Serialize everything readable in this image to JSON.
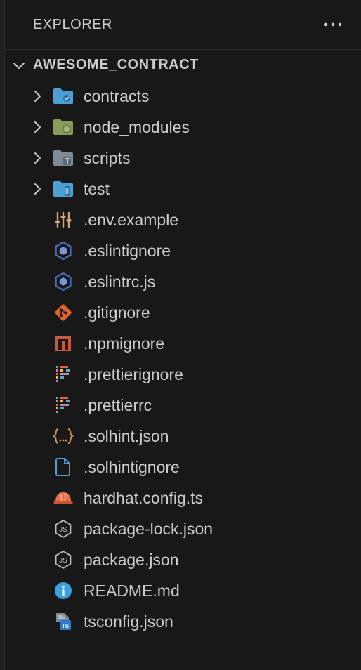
{
  "explorer": {
    "title": "EXPLORER",
    "section_title": "AWESOME_CONTRACT",
    "items": [
      {
        "label": "contracts",
        "kind": "folder",
        "icon": "folder-contracts-icon"
      },
      {
        "label": "node_modules",
        "kind": "folder",
        "icon": "folder-node-icon"
      },
      {
        "label": "scripts",
        "kind": "folder",
        "icon": "folder-scripts-icon"
      },
      {
        "label": "test",
        "kind": "folder",
        "icon": "folder-test-icon"
      },
      {
        "label": ".env.example",
        "kind": "file",
        "icon": "env-settings-icon"
      },
      {
        "label": ".eslintignore",
        "kind": "file",
        "icon": "eslint-icon"
      },
      {
        "label": ".eslintrc.js",
        "kind": "file",
        "icon": "eslint-icon"
      },
      {
        "label": ".gitignore",
        "kind": "file",
        "icon": "git-icon"
      },
      {
        "label": ".npmignore",
        "kind": "file",
        "icon": "npm-icon"
      },
      {
        "label": ".prettierignore",
        "kind": "file",
        "icon": "prettier-icon"
      },
      {
        "label": ".prettierrc",
        "kind": "file",
        "icon": "prettier-icon"
      },
      {
        "label": ".solhint.json",
        "kind": "file",
        "icon": "json-braces-icon"
      },
      {
        "label": ".solhintignore",
        "kind": "file",
        "icon": "file-icon"
      },
      {
        "label": "hardhat.config.ts",
        "kind": "file",
        "icon": "hardhat-icon"
      },
      {
        "label": "package-lock.json",
        "kind": "file",
        "icon": "nodejs-icon"
      },
      {
        "label": "package.json",
        "kind": "file",
        "icon": "nodejs-icon"
      },
      {
        "label": "README.md",
        "kind": "file",
        "icon": "info-icon"
      },
      {
        "label": "tsconfig.json",
        "kind": "file",
        "icon": "tsconfig-icon"
      }
    ]
  },
  "colors": {
    "background": "#181818",
    "text": "#cccccc",
    "folder_blue": "#4d9fd6",
    "folder_gray": "#7d8b96",
    "node_green": "#8a9a5b",
    "git_orange": "#e0622f",
    "npm_orange": "#cb5a3a",
    "json_orange": "#cf9a5c",
    "hardhat_orange": "#e4704c",
    "info_blue": "#3aa0e0",
    "eslint_blue": "#4b6cb7"
  }
}
